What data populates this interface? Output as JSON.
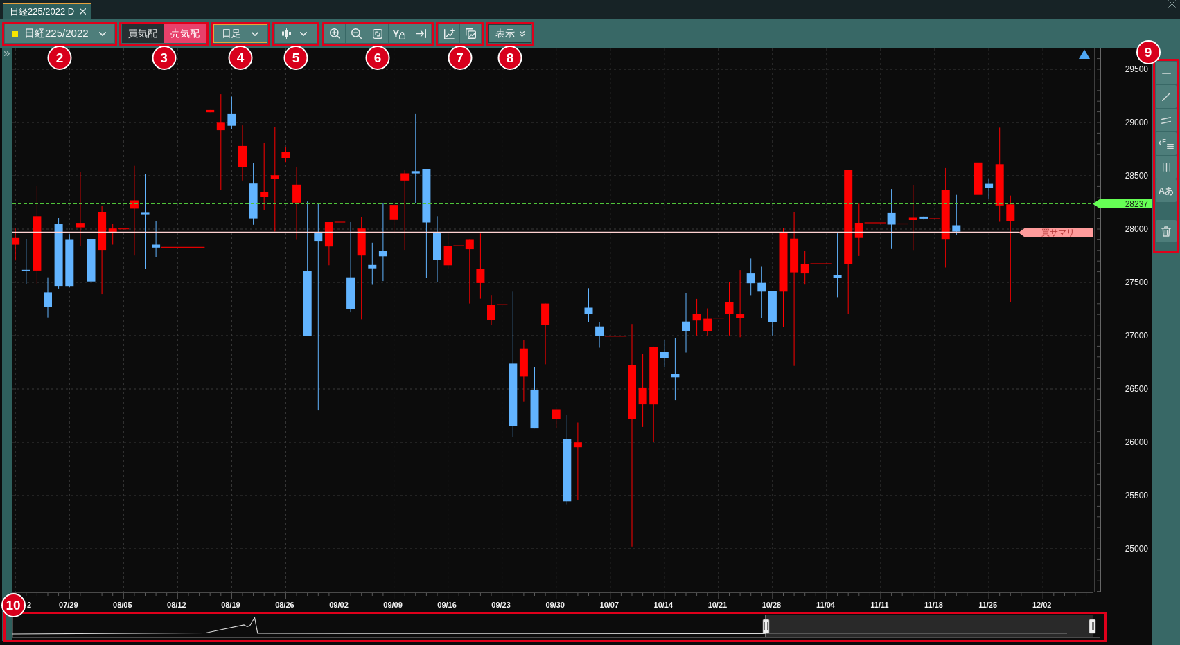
{
  "window": {
    "tab": {
      "title": "日経225/2022 D",
      "selected": true
    }
  },
  "toolbar": [
    {
      "callout": "2",
      "items": [
        {
          "kind": "symbol-dropdown",
          "label": "日経225/2022"
        }
      ]
    },
    {
      "callout": "3",
      "items": [
        {
          "kind": "toggle",
          "label": "買気配",
          "selected": false
        },
        {
          "kind": "toggle",
          "label": "売気配",
          "selected": true
        }
      ]
    },
    {
      "callout": "4",
      "items": [
        {
          "kind": "dropdown",
          "label": "日足",
          "focused": true
        }
      ]
    },
    {
      "callout": "5",
      "items": [
        {
          "kind": "chart-type-dropdown"
        }
      ]
    },
    {
      "callout": "6",
      "items": [
        {
          "kind": "zoom-in"
        },
        {
          "kind": "zoom-out"
        },
        {
          "kind": "fit"
        },
        {
          "kind": "y-lock",
          "label": "Y"
        },
        {
          "kind": "scroll-end"
        }
      ]
    },
    {
      "callout": "7",
      "items": [
        {
          "kind": "add-indicator"
        },
        {
          "kind": "save-image"
        }
      ]
    },
    {
      "callout": "8",
      "items": [
        {
          "kind": "display-menu",
          "label": "表示"
        }
      ]
    }
  ],
  "chart": {
    "y_ticks": [
      "29500",
      "29000",
      "28500",
      "28000",
      "27500",
      "27000",
      "26500",
      "26000",
      "25500",
      "25000"
    ],
    "x_ticks": [
      "2",
      "07/29",
      "08/05",
      "08/12",
      "08/19",
      "08/26",
      "09/02",
      "09/09",
      "09/16",
      "09/23",
      "09/30",
      "10/07",
      "10/14",
      "10/21",
      "10/28",
      "11/04",
      "11/11",
      "11/18",
      "11/25",
      "12/02"
    ],
    "last_price_tag": "28237",
    "position_tag": "買サマリ"
  },
  "navigator": {
    "callout": "10"
  },
  "drawing_tools": {
    "callout": "9",
    "items": [
      {
        "kind": "horizontal-line"
      },
      {
        "kind": "trend-line"
      },
      {
        "kind": "parallel-lines"
      },
      {
        "kind": "fibonacci",
        "label": "F"
      },
      {
        "kind": "vertical-lines"
      },
      {
        "kind": "text",
        "label": "Aあ"
      },
      {
        "kind": "delete"
      }
    ]
  }
}
